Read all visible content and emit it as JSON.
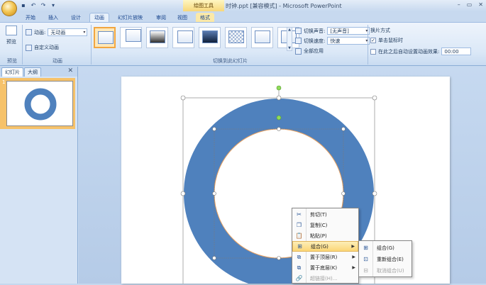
{
  "titlebar": {
    "context_tool": "绘图工具",
    "title": "时钟.ppt [兼容模式] - Microsoft PowerPoint",
    "controls": [
      "–",
      "▭",
      "✕"
    ]
  },
  "tabs": [
    "开始",
    "插入",
    "设计",
    "动画",
    "幻灯片放映",
    "审阅",
    "视图",
    "格式"
  ],
  "active_tab": "动画",
  "ribbon": {
    "preview": {
      "label": "预览",
      "group": "预览"
    },
    "animation": {
      "anim_label": "动画:",
      "anim_value": "无动画",
      "custom_label": "自定义动画",
      "group": "动画"
    },
    "transition": {
      "sound_label": "切换声音:",
      "sound_value": "[无声音]",
      "speed_label": "切换速度:",
      "speed_value": "快速",
      "apply_all": "全部应用",
      "group": "切换到此幻灯片"
    },
    "advance": {
      "title": "换片方式",
      "on_click": "单击鼠标时",
      "on_click_checked": true,
      "auto_label": "在此之后自动设置动画效果:",
      "auto_value": "00:00",
      "auto_checked": false
    }
  },
  "left_pane": {
    "tabs": [
      "幻灯片",
      "大纲"
    ],
    "close": "✕",
    "slide_number": "1"
  },
  "context_menu": {
    "items": [
      {
        "label": "剪切(T)",
        "icon": "scissors-icon",
        "glyph": "✂",
        "disabled": false,
        "submenu": false,
        "highlight": false
      },
      {
        "label": "复制(C)",
        "icon": "copy-icon",
        "glyph": "❐",
        "disabled": false,
        "submenu": false,
        "highlight": false
      },
      {
        "label": "粘贴(P)",
        "icon": "paste-icon",
        "glyph": "📋",
        "disabled": false,
        "submenu": false,
        "highlight": false
      },
      {
        "label": "组合(G)",
        "icon": "group-icon",
        "glyph": "⊞",
        "disabled": false,
        "submenu": true,
        "highlight": true
      },
      {
        "label": "置于顶层(R)",
        "icon": "bring-front-icon",
        "glyph": "⧉",
        "disabled": false,
        "submenu": true,
        "highlight": false
      },
      {
        "label": "置于底层(K)",
        "icon": "send-back-icon",
        "glyph": "⧉",
        "disabled": false,
        "submenu": true,
        "highlight": false
      },
      {
        "label": "超链接(H)...",
        "icon": "hyperlink-icon",
        "glyph": "🔗",
        "disabled": true,
        "submenu": false,
        "highlight": false
      }
    ],
    "submenu": [
      {
        "label": "组合(G)",
        "icon": "group-icon",
        "glyph": "⊞",
        "disabled": false
      },
      {
        "label": "重新组合(E)",
        "icon": "regroup-icon",
        "glyph": "⊡",
        "disabled": false
      },
      {
        "label": "取消组合(U)",
        "icon": "ungroup-icon",
        "glyph": "⊟",
        "disabled": true
      }
    ]
  },
  "colors": {
    "ring_fill": "#4f81bd",
    "ring_inner_stroke": "#e8a060",
    "selection_handle": "#ffffff",
    "rotation_handle": "#8fdc5a",
    "thumb_selected": "#f2a640"
  }
}
